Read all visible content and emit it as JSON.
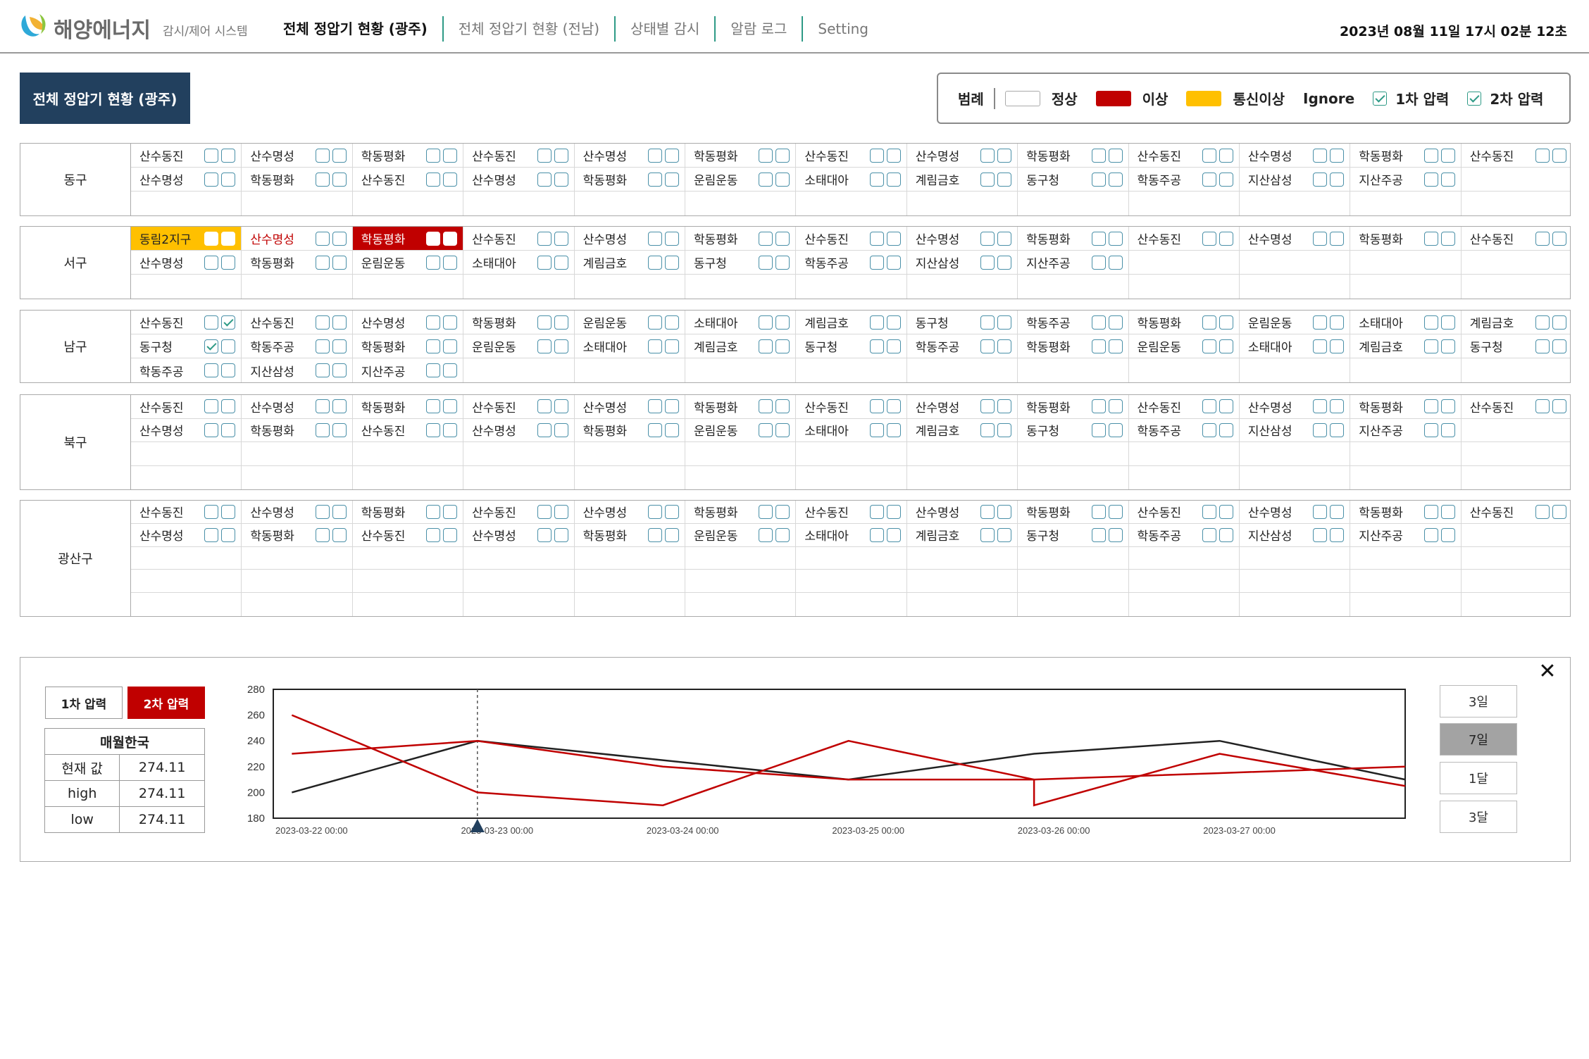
{
  "header": {
    "brand": "해양에너지",
    "subtitle": "감시/제어 시스템",
    "nav": [
      "전체 정압기 현황 (광주)",
      "전체 정압기 현황 (전남)",
      "상태별 감시",
      "알람 로그",
      "Setting"
    ],
    "active_nav": 0,
    "datetime": "2023년 08월 11일 17시 02분 12초"
  },
  "page_title": "전체 정압기 현황 (광주)",
  "legend": {
    "title": "범례",
    "normal": "정상",
    "abnormal": "이상",
    "comm_error": "통신이상",
    "ignore": "Ignore",
    "p1": "1차 압력",
    "p2": "2차 압력",
    "colors": {
      "abnormal": "#c00000",
      "comm_error": "#ffc000",
      "normal": "#ffffff"
    }
  },
  "regions": [
    {
      "name": "동구",
      "rows": 3,
      "stations": [
        {
          "name": "산수동진"
        },
        {
          "name": "산수명성"
        },
        {
          "name": "학동평화"
        },
        {
          "name": "산수동진"
        },
        {
          "name": "산수명성"
        },
        {
          "name": "학동평화"
        },
        {
          "name": "산수동진"
        },
        {
          "name": "산수명성"
        },
        {
          "name": "학동평화"
        },
        {
          "name": "산수동진"
        },
        {
          "name": "산수명성"
        },
        {
          "name": "학동평화"
        },
        {
          "name": "산수동진"
        },
        {
          "name": "산수명성"
        },
        {
          "name": "학동평화"
        },
        {
          "name": "산수동진"
        },
        {
          "name": "산수명성"
        },
        {
          "name": "학동평화"
        },
        {
          "name": "운림운동"
        },
        {
          "name": "소태대아"
        },
        {
          "name": "계림금호"
        },
        {
          "name": "동구청"
        },
        {
          "name": "학동주공"
        },
        {
          "name": "지산삼성"
        },
        {
          "name": "지산주공"
        }
      ]
    },
    {
      "name": "서구",
      "rows": 3,
      "stations": [
        {
          "name": "동림2지구",
          "status": "comm"
        },
        {
          "name": "산수명성",
          "status": "redtext"
        },
        {
          "name": "학동평화",
          "status": "abn"
        },
        {
          "name": "산수동진"
        },
        {
          "name": "산수명성"
        },
        {
          "name": "학동평화"
        },
        {
          "name": "산수동진"
        },
        {
          "name": "산수명성"
        },
        {
          "name": "학동평화"
        },
        {
          "name": "산수동진"
        },
        {
          "name": "산수명성"
        },
        {
          "name": "학동평화"
        },
        {
          "name": "산수동진"
        },
        {
          "name": "산수명성"
        },
        {
          "name": "학동평화"
        },
        {
          "name": "운림운동"
        },
        {
          "name": "소태대아"
        },
        {
          "name": "계림금호"
        },
        {
          "name": "동구청"
        },
        {
          "name": "학동주공"
        },
        {
          "name": "지산삼성"
        },
        {
          "name": "지산주공"
        }
      ]
    },
    {
      "name": "남구",
      "rows": 3,
      "stations": [
        {
          "name": "산수동진",
          "p2": true
        },
        {
          "name": "산수동진"
        },
        {
          "name": "산수명성"
        },
        {
          "name": "학동평화"
        },
        {
          "name": "운림운동"
        },
        {
          "name": "소태대아"
        },
        {
          "name": "계림금호"
        },
        {
          "name": "동구청"
        },
        {
          "name": "학동주공"
        },
        {
          "name": "학동평화"
        },
        {
          "name": "운림운동"
        },
        {
          "name": "소태대아"
        },
        {
          "name": "계림금호"
        },
        {
          "name": "동구청",
          "p1": true
        },
        {
          "name": "학동주공"
        },
        {
          "name": "학동평화"
        },
        {
          "name": "운림운동"
        },
        {
          "name": "소태대아"
        },
        {
          "name": "계림금호"
        },
        {
          "name": "동구청"
        },
        {
          "name": "학동주공"
        },
        {
          "name": "학동평화"
        },
        {
          "name": "운림운동"
        },
        {
          "name": "소태대아"
        },
        {
          "name": "계림금호"
        },
        {
          "name": "동구청"
        },
        {
          "name": "학동주공"
        },
        {
          "name": "지산삼성"
        },
        {
          "name": "지산주공"
        }
      ]
    },
    {
      "name": "북구",
      "rows": 4,
      "stations": [
        {
          "name": "산수동진"
        },
        {
          "name": "산수명성"
        },
        {
          "name": "학동평화"
        },
        {
          "name": "산수동진"
        },
        {
          "name": "산수명성"
        },
        {
          "name": "학동평화"
        },
        {
          "name": "산수동진"
        },
        {
          "name": "산수명성"
        },
        {
          "name": "학동평화"
        },
        {
          "name": "산수동진"
        },
        {
          "name": "산수명성"
        },
        {
          "name": "학동평화"
        },
        {
          "name": "산수동진"
        },
        {
          "name": "산수명성"
        },
        {
          "name": "학동평화"
        },
        {
          "name": "산수동진"
        },
        {
          "name": "산수명성"
        },
        {
          "name": "학동평화"
        },
        {
          "name": "운림운동"
        },
        {
          "name": "소태대아"
        },
        {
          "name": "계림금호"
        },
        {
          "name": "동구청"
        },
        {
          "name": "학동주공"
        },
        {
          "name": "지산삼성"
        },
        {
          "name": "지산주공"
        }
      ]
    },
    {
      "name": "광산구",
      "rows": 5,
      "stations": [
        {
          "name": "산수동진"
        },
        {
          "name": "산수명성"
        },
        {
          "name": "학동평화"
        },
        {
          "name": "산수동진"
        },
        {
          "name": "산수명성"
        },
        {
          "name": "학동평화"
        },
        {
          "name": "산수동진"
        },
        {
          "name": "산수명성"
        },
        {
          "name": "학동평화"
        },
        {
          "name": "산수동진"
        },
        {
          "name": "산수명성"
        },
        {
          "name": "학동평화"
        },
        {
          "name": "산수동진"
        },
        {
          "name": "산수명성"
        },
        {
          "name": "학동평화"
        },
        {
          "name": "산수동진"
        },
        {
          "name": "산수명성"
        },
        {
          "name": "학동평화"
        },
        {
          "name": "운림운동"
        },
        {
          "name": "소태대아"
        },
        {
          "name": "계림금호"
        },
        {
          "name": "동구청"
        },
        {
          "name": "학동주공"
        },
        {
          "name": "지산삼성"
        },
        {
          "name": "지산주공"
        }
      ]
    }
  ],
  "detail": {
    "pressure_buttons": [
      "1차 압력",
      "2차 압력"
    ],
    "selected_pressure": 1,
    "station": "매월한국",
    "stats": [
      {
        "label": "현재 값",
        "value": "274.11"
      },
      {
        "label": "high",
        "value": "274.11"
      },
      {
        "label": "low",
        "value": "274.11"
      }
    ],
    "ranges": [
      "3일",
      "7일",
      "1달",
      "3달"
    ],
    "selected_range": 1,
    "close_icon": "close-icon"
  },
  "chart_data": {
    "type": "line",
    "x": [
      "2023-03-22 00:00",
      "2023-03-22 12:00",
      "2023-03-23 00:00",
      "2023-03-23 12:00",
      "2023-03-24 00:00",
      "2023-03-24 12:00",
      "2023-03-25 00:00",
      "2023-03-25 12:00",
      "2023-03-26 00:00",
      "2023-03-26 12:00",
      "2023-03-27 00:00",
      "2023-03-27 12:00",
      "2023-03-28 00:00"
    ],
    "tick_labels": [
      "2023-03-22 00:00",
      "2023-03-23 00:00",
      "2023-03-24 00:00",
      "2023-03-25 00:00",
      "2023-03-26 00:00",
      "2023-03-27 00:00"
    ],
    "ylim": [
      180,
      280
    ],
    "yticks": [
      280,
      260,
      240,
      220,
      200,
      180
    ],
    "marker_x": "2023-03-23 00:00",
    "series": [
      {
        "color": "#222222",
        "points": [
          [
            "2023-03-22 00:00",
            200
          ],
          [
            "2023-03-23 00:00",
            240
          ],
          [
            "2023-03-25 00:00",
            210
          ],
          [
            "2023-03-26 00:00",
            230
          ],
          [
            "2023-03-27 00:00",
            240
          ],
          [
            "2023-03-28 00:00",
            210
          ]
        ]
      },
      {
        "color": "#c00000",
        "points": [
          [
            "2023-03-22 00:00",
            260
          ],
          [
            "2023-03-23 00:00",
            200
          ],
          [
            "2023-03-24 00:00",
            190
          ],
          [
            "2023-03-25 00:00",
            240
          ],
          [
            "2023-03-26 00:00",
            210
          ],
          [
            "2023-03-26 00:00",
            190
          ],
          [
            "2023-03-27 00:00",
            230
          ],
          [
            "2023-03-28 00:00",
            205
          ]
        ]
      },
      {
        "color": "#c00000",
        "points": [
          [
            "2023-03-22 00:00",
            230
          ],
          [
            "2023-03-23 00:00",
            240
          ],
          [
            "2023-03-24 00:00",
            220
          ],
          [
            "2023-03-25 00:00",
            210
          ],
          [
            "2023-03-26 00:00",
            210
          ],
          [
            "2023-03-27 00:00",
            215
          ],
          [
            "2023-03-28 00:00",
            220
          ]
        ]
      }
    ],
    "grid": false,
    "legend": "none"
  }
}
